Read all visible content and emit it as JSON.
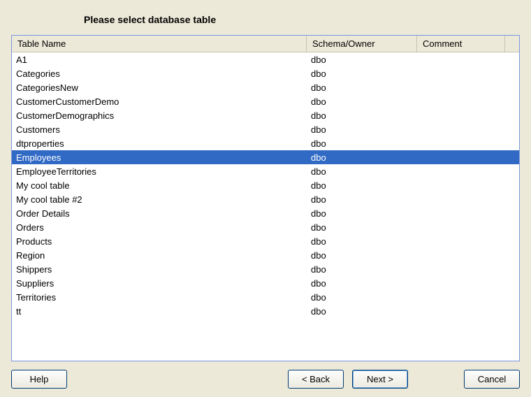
{
  "title": "Please select database table",
  "columns": {
    "name": "Table Name",
    "schema": "Schema/Owner",
    "comment": "Comment"
  },
  "rows": [
    {
      "name": "A1",
      "schema": "dbo",
      "comment": "",
      "selected": false
    },
    {
      "name": "Categories",
      "schema": "dbo",
      "comment": "",
      "selected": false
    },
    {
      "name": "CategoriesNew",
      "schema": "dbo",
      "comment": "",
      "selected": false
    },
    {
      "name": "CustomerCustomerDemo",
      "schema": "dbo",
      "comment": "",
      "selected": false
    },
    {
      "name": "CustomerDemographics",
      "schema": "dbo",
      "comment": "",
      "selected": false
    },
    {
      "name": "Customers",
      "schema": "dbo",
      "comment": "",
      "selected": false
    },
    {
      "name": "dtproperties",
      "schema": "dbo",
      "comment": "",
      "selected": false
    },
    {
      "name": "Employees",
      "schema": "dbo",
      "comment": "",
      "selected": true
    },
    {
      "name": "EmployeeTerritories",
      "schema": "dbo",
      "comment": "",
      "selected": false
    },
    {
      "name": "My cool table",
      "schema": "dbo",
      "comment": "",
      "selected": false
    },
    {
      "name": "My cool table #2",
      "schema": "dbo",
      "comment": "",
      "selected": false
    },
    {
      "name": "Order Details",
      "schema": "dbo",
      "comment": "",
      "selected": false
    },
    {
      "name": "Orders",
      "schema": "dbo",
      "comment": "",
      "selected": false
    },
    {
      "name": "Products",
      "schema": "dbo",
      "comment": "",
      "selected": false
    },
    {
      "name": "Region",
      "schema": "dbo",
      "comment": "",
      "selected": false
    },
    {
      "name": "Shippers",
      "schema": "dbo",
      "comment": "",
      "selected": false
    },
    {
      "name": "Suppliers",
      "schema": "dbo",
      "comment": "",
      "selected": false
    },
    {
      "name": "Territories",
      "schema": "dbo",
      "comment": "",
      "selected": false
    },
    {
      "name": "tt",
      "schema": "dbo",
      "comment": "",
      "selected": false
    }
  ],
  "buttons": {
    "help": "Help",
    "back": "< Back",
    "next": "Next >",
    "cancel": "Cancel"
  }
}
